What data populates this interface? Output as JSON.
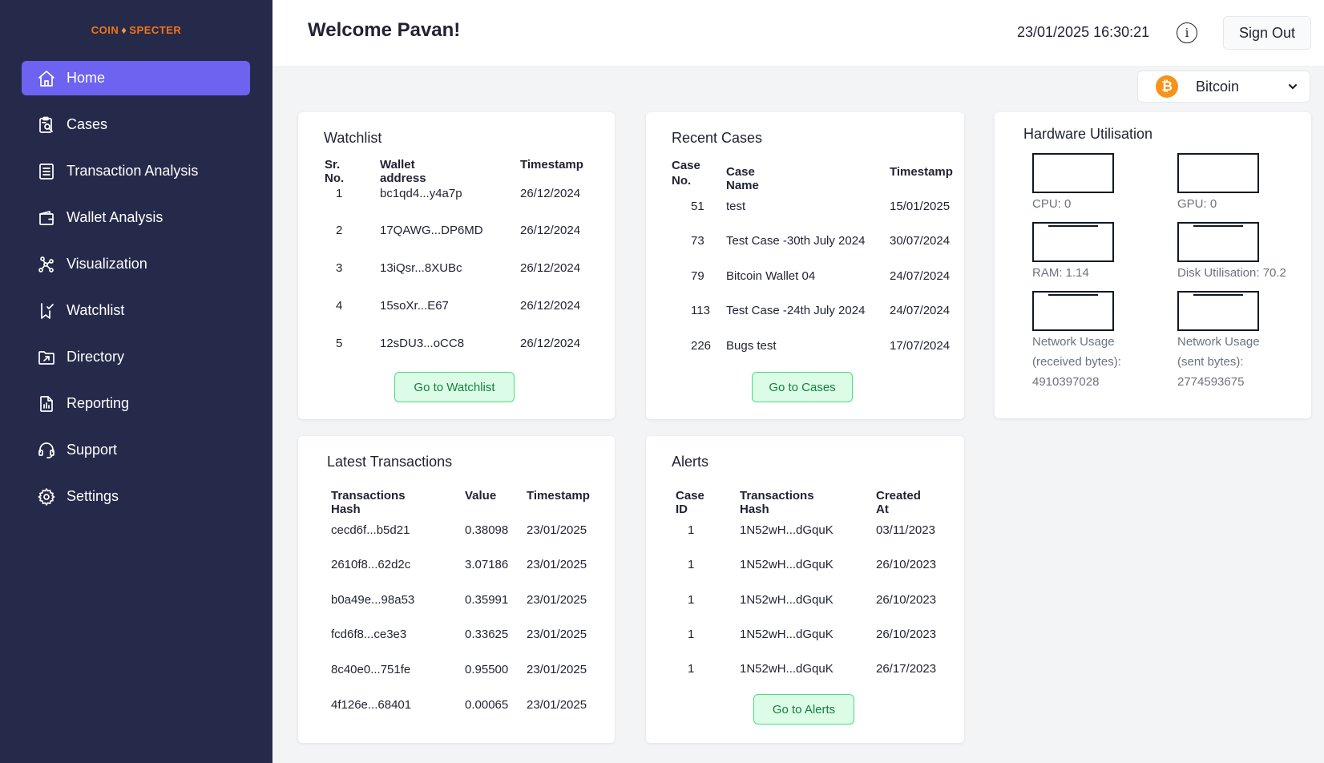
{
  "app": {
    "logo": {
      "left": "COIN",
      "right": "SPECTER"
    },
    "welcome": "Welcome Pavan!",
    "datetime": "23/01/2025 16:30:21",
    "sign_out": "Sign Out",
    "info_icon": "info-icon",
    "coin": {
      "selected": "Bitcoin",
      "icon_glyph": "₿",
      "color": "#f7931a"
    },
    "colors": {
      "sidebar": "#252a4a",
      "active_nav": "#6d63f0",
      "button_bg": "#dcfce7",
      "button_border": "#4ade80",
      "button_text": "#15803d"
    }
  },
  "sidebar": {
    "items": [
      {
        "label": "Home",
        "icon": "home-icon",
        "active": true
      },
      {
        "label": "Cases",
        "icon": "cases-icon",
        "active": false
      },
      {
        "label": "Transaction Analysis",
        "icon": "transaction-analysis-icon",
        "active": false
      },
      {
        "label": "Wallet Analysis",
        "icon": "wallet-icon",
        "active": false
      },
      {
        "label": "Visualization",
        "icon": "visualization-icon",
        "active": false
      },
      {
        "label": "Watchlist",
        "icon": "watchlist-icon",
        "active": false
      },
      {
        "label": "Directory",
        "icon": "directory-icon",
        "active": false
      },
      {
        "label": "Reporting",
        "icon": "reporting-icon",
        "active": false
      },
      {
        "label": "Support",
        "icon": "support-icon",
        "active": false
      },
      {
        "label": "Settings",
        "icon": "settings-icon",
        "active": false
      }
    ]
  },
  "watchlist": {
    "title": "Watchlist",
    "headers": [
      "Sr. No.",
      "Wallet address",
      "Timestamp"
    ],
    "rows": [
      [
        "1",
        "bc1qd4...y4a7p",
        "26/12/2024"
      ],
      [
        "2",
        "17QAWG...DP6MD",
        "26/12/2024"
      ],
      [
        "3",
        "13iQsr...8XUBc",
        "26/12/2024"
      ],
      [
        "4",
        "15soXr...E67",
        "26/12/2024"
      ],
      [
        "5",
        "12sDU3...oCC8",
        "26/12/2024"
      ]
    ],
    "button": "Go to Watchlist"
  },
  "recent_cases": {
    "title": "Recent Cases",
    "headers": [
      "Case No.",
      "Case Name",
      "Timestamp"
    ],
    "header_case_line1": "Case",
    "header_case_line2": "No.",
    "rows": [
      [
        "51",
        "test",
        "15/01/2025"
      ],
      [
        "73",
        "Test Case -30th July 2024",
        "30/07/2024"
      ],
      [
        "79",
        "Bitcoin Wallet 04",
        "24/07/2024"
      ],
      [
        "113",
        "Test Case -24th July 2024",
        "24/07/2024"
      ],
      [
        "226",
        "Bugs test",
        "17/07/2024"
      ]
    ],
    "button": "Go to Cases"
  },
  "hardware": {
    "title": "Hardware Utilisation",
    "items": [
      {
        "label": "CPU: 0",
        "level": 0
      },
      {
        "label": "GPU: 0",
        "level": 0
      },
      {
        "label": "RAM: 1.14",
        "level": 1.14
      },
      {
        "label": "Disk Utilisation: 70.2",
        "level": 70.2
      },
      {
        "label_lines": [
          "Network Usage",
          "(received bytes):",
          "4910397028"
        ]
      },
      {
        "label_lines": [
          "Network Usage",
          "(sent bytes):",
          "2774593675"
        ]
      }
    ]
  },
  "latest_transactions": {
    "title": "Latest Transactions",
    "headers": [
      "Transactions Hash",
      "Value",
      "Timestamp"
    ],
    "rows": [
      [
        "cecd6f...b5d21",
        "0.38098",
        "23/01/2025"
      ],
      [
        "2610f8...62d2c",
        "3.07186",
        "23/01/2025"
      ],
      [
        "b0a49e...98a53",
        "0.35991",
        "23/01/2025"
      ],
      [
        "fcd6f8...ce3e3",
        "0.33625",
        "23/01/2025"
      ],
      [
        "8c40e0...751fe",
        "0.95500",
        "23/01/2025"
      ],
      [
        "4f126e...68401",
        "0.00065",
        "23/01/2025"
      ]
    ]
  },
  "alerts": {
    "title": "Alerts",
    "headers": [
      "Case ID",
      "Transactions Hash",
      "Created At"
    ],
    "rows": [
      [
        "1",
        "1N52wH...dGquK",
        "03/11/2023"
      ],
      [
        "1",
        "1N52wH...dGquK",
        "26/10/2023"
      ],
      [
        "1",
        "1N52wH...dGquK",
        "26/10/2023"
      ],
      [
        "1",
        "1N52wH...dGquK",
        "26/10/2023"
      ],
      [
        "1",
        "1N52wH...dGquK",
        "26/17/2023"
      ]
    ],
    "button": "Go to Alerts"
  }
}
